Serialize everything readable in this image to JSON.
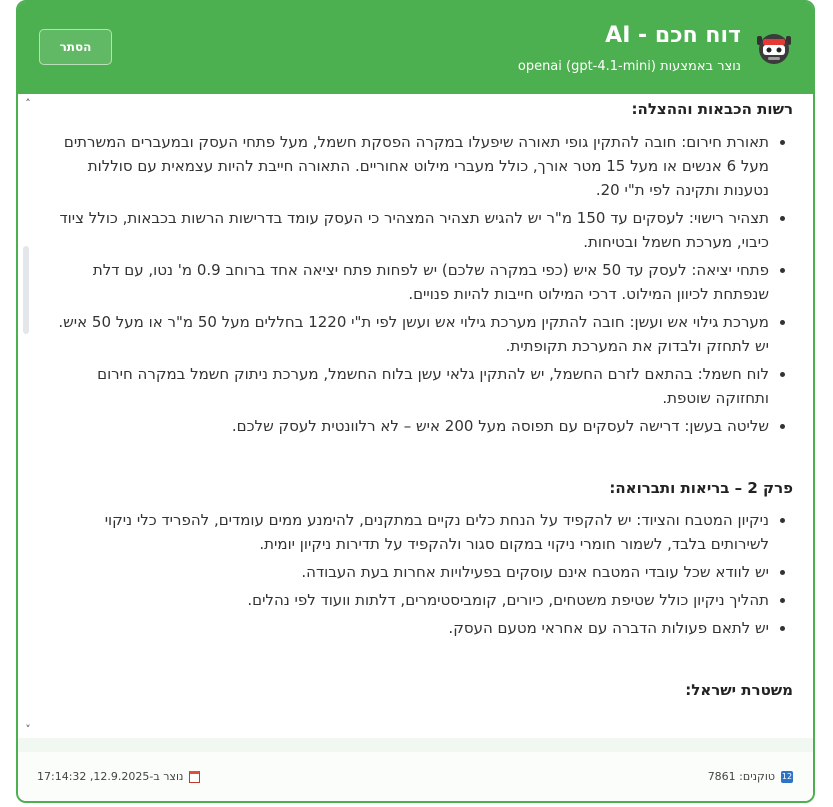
{
  "header": {
    "title": "דוח חכם - AI",
    "subtitle": "נוצר באמצעות openai (gpt-4.1-mini)",
    "hide_label": "הסתר",
    "icon": "robot-icon"
  },
  "sections": [
    {
      "title": "רשות הכבאות וההצלה:",
      "items": [
        "תאורת חירום: חובה להתקין גופי תאורה שיפעלו במקרה הפסקת חשמל, מעל פתחי העסק ובמעברים המשרתים מעל 6 אנשים או מעל 15 מטר אורך, כולל מעברי מילוט אחוריים. התאורה חייבת להיות עצמאית עם סוללות נטענות ותקינה לפי ת\"י 20.",
        "תצהיר רישוי: לעסקים עד 150 מ\"ר יש להגיש תצהיר המצהיר כי העסק עומד בדרישות הרשות בכבאות, כולל ציוד כיבוי, מערכת חשמל ובטיחות.",
        "פתחי יציאה: לעסק עד 50 איש (כפי במקרה שלכם) יש לפחות פתח יציאה אחד ברוחב 0.9 מ' נטו, עם דלת שנפתחת לכיוון המילוט. דרכי המילוט חייבות להיות פנויים.",
        "מערכת גילוי אש ועשן: חובה להתקין מערכת גילוי אש ועשן לפי ת\"י 1220 בחללים מעל 50 מ\"ר או מעל 50 איש. יש לתחזק ולבדוק את המערכת תקופתית.",
        "לוח חשמל: בהתאם לזרם החשמל, יש להתקין גלאי עשן בלוח החשמל, מערכת ניתוק חשמל במקרה חירום ותחזוקה שוטפת.",
        "שליטה בעשן: דרישה לעסקים עם תפוסה מעל 200 איש – לא רלוונטית לעסק שלכם."
      ]
    },
    {
      "title": "פרק 2 – בריאות ותברואה:",
      "items": [
        "ניקיון המטבח והציוד: יש להקפיד על הנחת כלים נקיים במתקנים, להימנע ממים עומדים, להפריד כלי ניקוי לשירותים בלבד, לשמור חומרי ניקוי במקום סגור ולהקפיד על תדירות ניקיון יומית.",
        "יש לוודא שכל עובדי המטבח אינם עוסקים בפעילויות אחרות בעת העבודה.",
        "תהליך ניקיון כולל שטיפת משטחים, כיורים, קומביסטימרים, דלתות וועוד לפי נהלים.",
        "יש לתאם פעולות הדברה עם אחראי מטעם העסק."
      ]
    },
    {
      "title": "משטרת ישראל:",
      "items": []
    }
  ],
  "footer": {
    "created": "נוצר ב-12.9.2025, 17:14:32",
    "tokens": "טוקנים: 7861",
    "calendar_icon": "calendar-icon",
    "tokens_icon": "numbers-icon"
  }
}
